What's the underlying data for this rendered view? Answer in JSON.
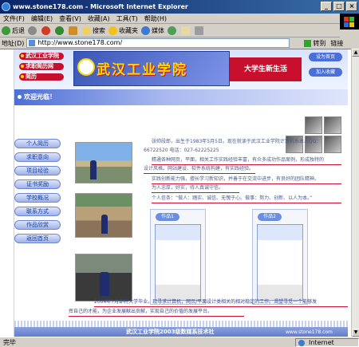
{
  "window": {
    "title": "www.stone178.com - Microsoft Internet Explorer"
  },
  "menu": [
    "文件(F)",
    "编辑(E)",
    "查看(V)",
    "收藏(A)",
    "工具(T)",
    "帮助(H)"
  ],
  "toolbar": {
    "back": "后退",
    "search": "搜索",
    "favorites": "收藏夹",
    "media": "媒体"
  },
  "address": {
    "label": "地址(D)",
    "url": "http://www.stone178.com/",
    "go": "转到",
    "links": "链接"
  },
  "status": {
    "left": "完毕",
    "zone": "Internet"
  },
  "page": {
    "banner": {
      "badges": [
        "武汉工业学院",
        "求职简历网",
        "简历"
      ],
      "title": "武汉工业学院",
      "slogan": "大学生新生活",
      "right_buttons": [
        "设为首页",
        "加入收藏"
      ]
    },
    "nav_label": "欢迎光临！",
    "side_menu": [
      "个人简历",
      "求职意向",
      "项目经验",
      "证书奖励",
      "学校概况",
      "联系方式",
      "作品欣赏",
      "返回首页"
    ],
    "intro_lines": [
      "张帅段郎，出生于1983年5月5日。现在就读于武汉工业学院计算机系本人QQ：",
      "66722520  电话：027-62225225",
      "精通各种网页，平面，相关工作实践经验丰富，有众多成功作品案例，形成独特的",
      "设计风格。网站建设、软件系统构建，有实践经验。",
      "实践创新能力强，擅长学习新知识，并善于在交流中进步，有良好的团队精神。",
      "为人忠厚，好实，待人真诚守信。",
      "个人信条：“做人：踏实、诚信、无愧于心。做事：努力、创新、以人为本。”"
    ],
    "card_tags": [
      "作品1",
      "作品2"
    ],
    "bottom_lines": [
      "2004年7月即将大学毕业。现寻求计算机，网页/平面设计类相关的相对稳定的工作。渴望寻觅一个能够发",
      "挥自己的才能，为企业发展献出贡献，实现自己的价值的发展平台。"
    ],
    "footer": {
      "center": "武汉工业学院2003级数媒系技术社",
      "right": "www.stone178.com"
    }
  }
}
